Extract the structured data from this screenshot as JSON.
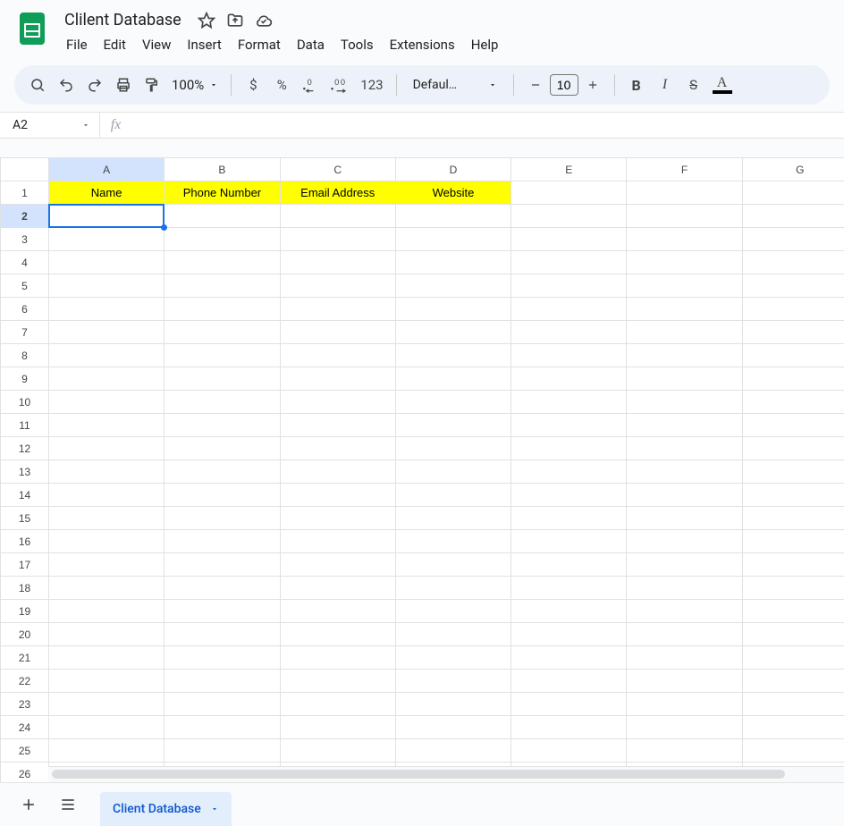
{
  "doc": {
    "title": "Clilent Database"
  },
  "menus": [
    "File",
    "Edit",
    "View",
    "Insert",
    "Format",
    "Data",
    "Tools",
    "Extensions",
    "Help"
  ],
  "toolbar": {
    "zoom": "100%",
    "font_name": "Defaul…",
    "font_size": "10",
    "currency": "$",
    "percent": "%",
    "num123": "123"
  },
  "namebox": {
    "value": "A2"
  },
  "formula": {
    "value": ""
  },
  "grid": {
    "columns": [
      "A",
      "B",
      "C",
      "D",
      "E",
      "F",
      "G"
    ],
    "rows": 26,
    "active_col": "A",
    "active_row": 2,
    "header_highlight": "#ffff00",
    "data": {
      "1": {
        "A": "Name",
        "B": "Phone Number",
        "C": "Email Address",
        "D": "Website"
      }
    }
  },
  "sheets": {
    "active": "Client Database"
  }
}
